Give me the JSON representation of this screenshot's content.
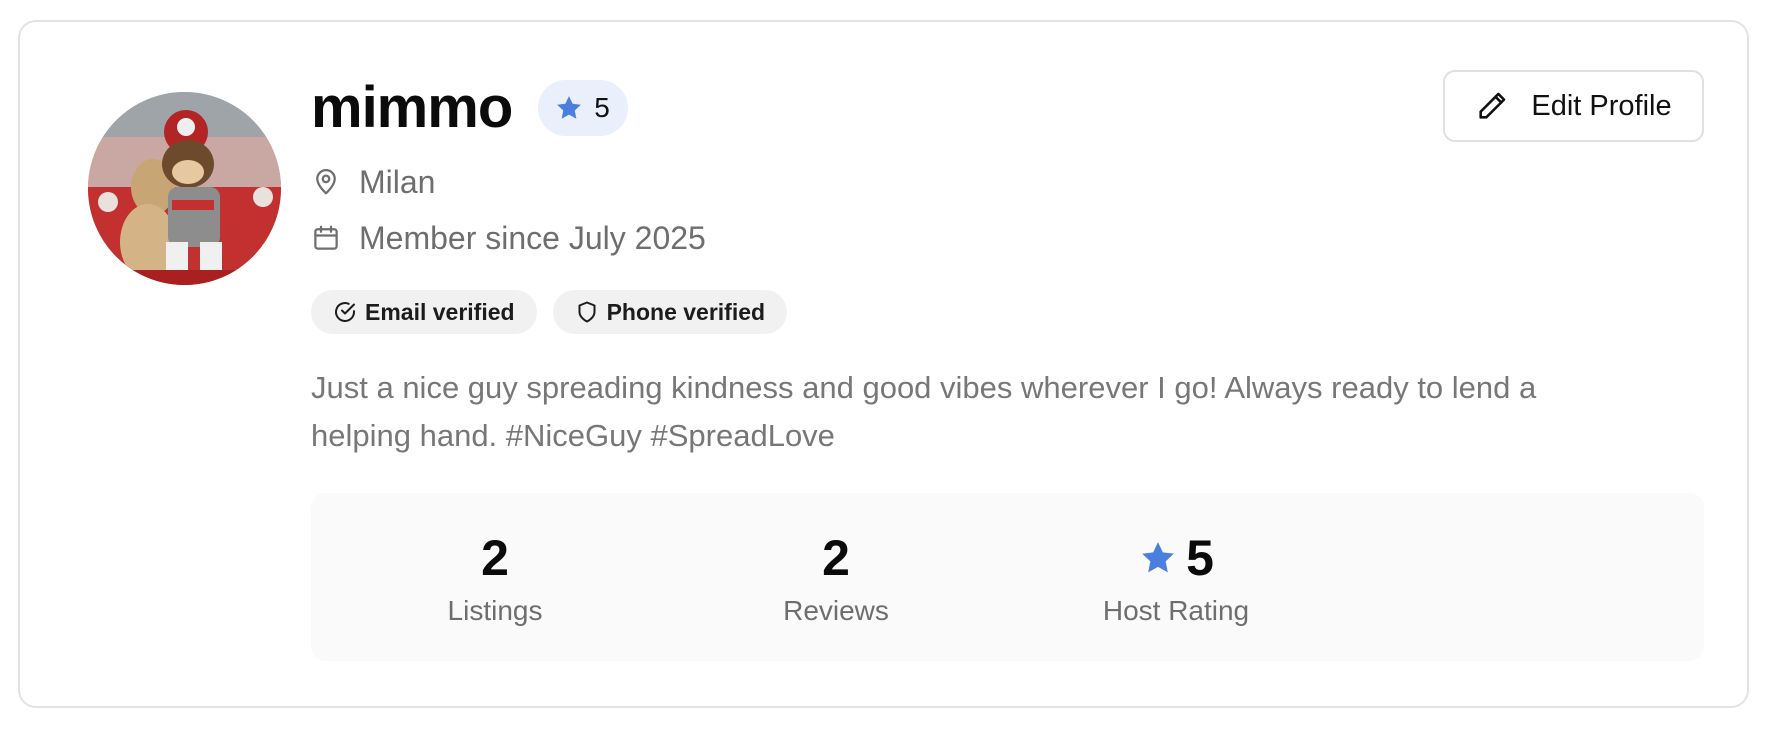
{
  "profile": {
    "username": "mimmo",
    "rating": "5",
    "location": "Milan",
    "member_since": "Member since July 2025",
    "badges": {
      "email": "Email verified",
      "phone": "Phone verified"
    },
    "bio": "Just a nice guy spreading kindness and good vibes wherever I go! Always ready to lend a helping hand. #NiceGuy #SpreadLove"
  },
  "actions": {
    "edit_profile_label": "Edit Profile"
  },
  "stats": {
    "listings": {
      "value": "2",
      "label": "Listings"
    },
    "reviews": {
      "value": "2",
      "label": "Reviews"
    },
    "host_rating": {
      "value": "5",
      "label": "Host Rating"
    }
  },
  "colors": {
    "accent_star": "#4a7fe0",
    "rating_badge_bg": "#e9effb",
    "muted_text": "#6e6e6e"
  },
  "icons": {
    "star": "star-icon",
    "location": "map-pin-icon",
    "calendar": "calendar-icon",
    "email_badge": "check-circle-icon",
    "phone_badge": "shield-icon",
    "edit": "pencil-icon"
  }
}
